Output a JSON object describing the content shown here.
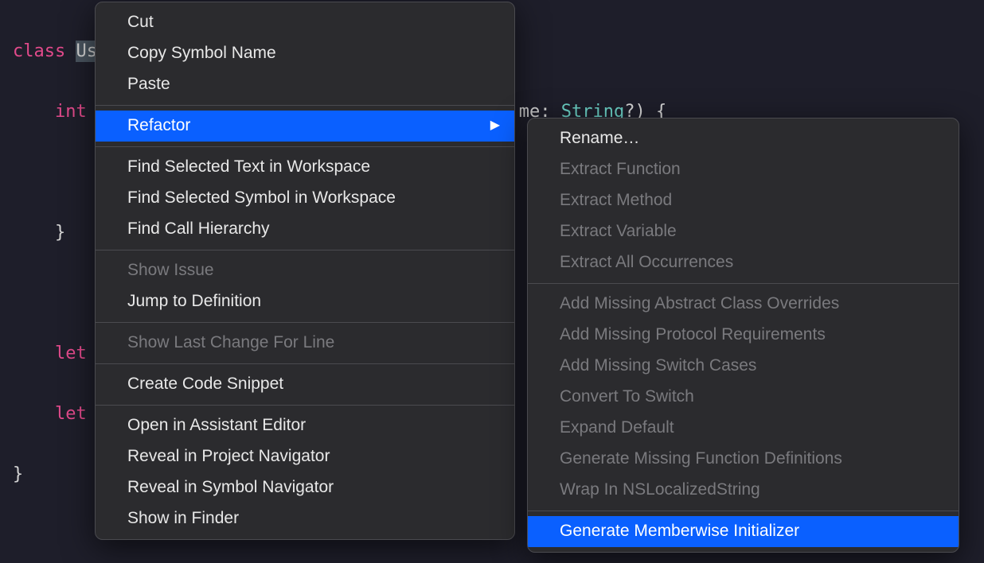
{
  "code": {
    "line1_kw": "class",
    "line1_hl": "Us",
    "line2_pre": "    int",
    "line2_mid": "me: ",
    "line2_type": "String",
    "line2_end": "?) {",
    "line3": "",
    "line4": "    }",
    "line5": "",
    "line6_kw": "    let",
    "line7_kw": "    let",
    "line8": "}"
  },
  "menu1": {
    "cut": "Cut",
    "copySymbol": "Copy Symbol Name",
    "paste": "Paste",
    "refactor": "Refactor",
    "findSelectedText": "Find Selected Text in Workspace",
    "findSelectedSymbol": "Find Selected Symbol in Workspace",
    "findCallHierarchy": "Find Call Hierarchy",
    "showIssue": "Show Issue",
    "jumpToDef": "Jump to Definition",
    "showLastChange": "Show Last Change For Line",
    "createCodeSnippet": "Create Code Snippet",
    "openAssistant": "Open in Assistant Editor",
    "revealProjectNav": "Reveal in Project Navigator",
    "revealSymbolNav": "Reveal in Symbol Navigator",
    "showInFinder": "Show in Finder"
  },
  "menu2": {
    "rename": "Rename…",
    "extractFunction": "Extract Function",
    "extractMethod": "Extract Method",
    "extractVariable": "Extract Variable",
    "extractAll": "Extract All Occurrences",
    "addAbstract": "Add Missing Abstract Class Overrides",
    "addProtocol": "Add Missing Protocol Requirements",
    "addSwitch": "Add Missing Switch Cases",
    "convertSwitch": "Convert To Switch",
    "expandDefault": "Expand Default",
    "generateMissing": "Generate Missing Function Definitions",
    "wrapNS": "Wrap In NSLocalizedString",
    "generateMemberwise": "Generate Memberwise Initializer"
  },
  "glyphs": {
    "arrow": "▶"
  }
}
